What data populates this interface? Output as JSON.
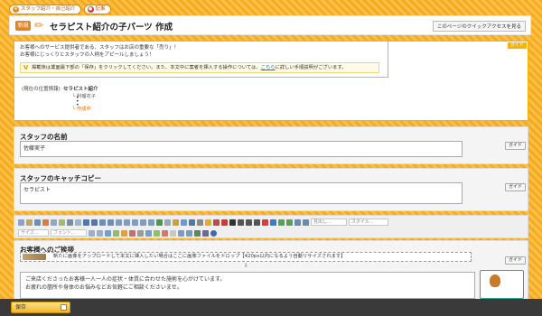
{
  "topbar": {
    "pill1": "スタッフ紹介・自己紹介",
    "pill2": "記事"
  },
  "header": {
    "badge": "新規",
    "title": "セラピスト紹介の子パーツ 作成",
    "quick_access": "このページのクイックアクセスを見る"
  },
  "info": {
    "guide_tag": "ガイド",
    "intro_line1": "お客様へのサービス提供者である、スタッフはお店の重要な「売り」！",
    "intro_line2": "お客様にじっくりとスタッフの人柄をアピールしましょう！",
    "note_pre": "掲載後は業面最下部の「保存」をクリックしてください。また、本文中に案者を挿入する操作については、",
    "note_link": "こちら",
    "note_post": "に詳しい手順説明がございます。",
    "location_label": "(現在の位置情報)",
    "location_current": "セラピスト紹介",
    "tree_item": "利瑠花子",
    "tree_creating": "作成中"
  },
  "staff_name": {
    "label": "スタッフの名前",
    "value": "佐藤実子",
    "guide": "ガイド"
  },
  "catchcopy": {
    "label": "スタッフのキャッチコピー",
    "value": "セラピスト",
    "guide": "ガイド"
  },
  "toolbar": {
    "styles_placeholder": "見出し...",
    "format_placeholder": "スタイル...",
    "size_placeholder": "サイズ...",
    "font_placeholder": "フォント..."
  },
  "greeting": {
    "label": "お客様へのご挨拶",
    "guide": "ガイド",
    "upload_hint": "新たに画像をアップロードして本文に挿入したい場合はここに画像ファイルをドロップ【420px以内になるよう自動リサイズされます】",
    "body_line1": "ご来店くださったお客様一人一人の症状・体質に合わせた施術を心がけています。",
    "body_line2": "お疲れの箇所や身体のお悩みなどお気軽にご相談くださいませ。"
  },
  "footer": {
    "save_label": "保存"
  }
}
